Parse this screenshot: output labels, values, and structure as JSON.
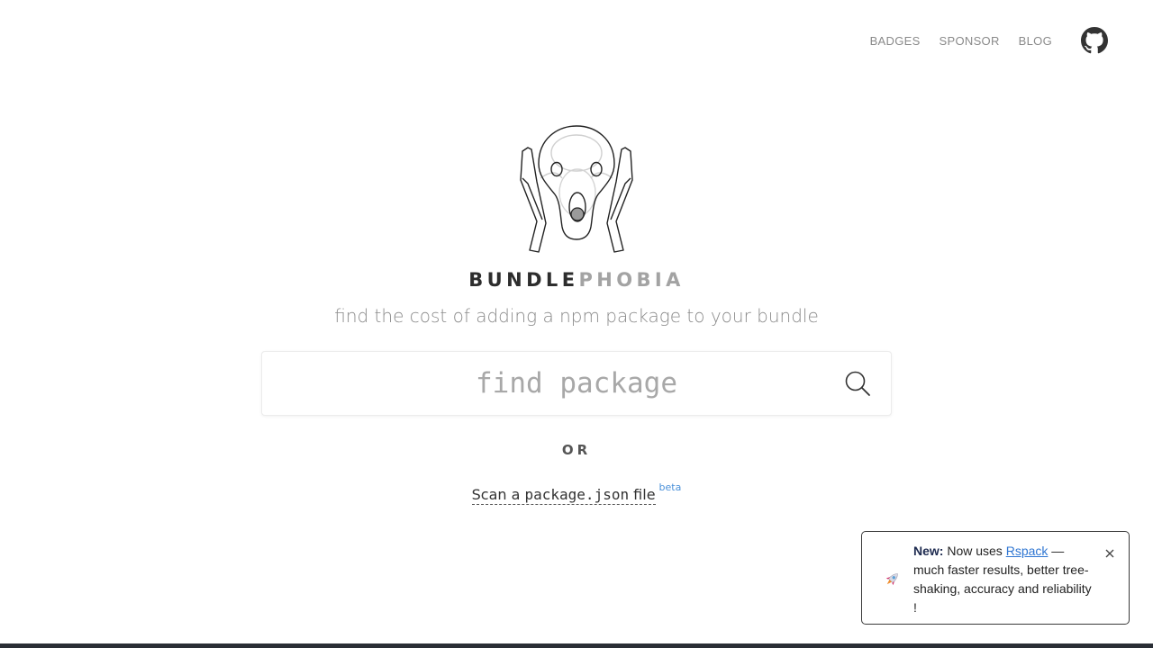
{
  "nav": {
    "items": [
      "BADGES",
      "SPONSOR",
      "BLOG"
    ],
    "github_icon": "github-icon"
  },
  "brand": {
    "part1": "BUNDLE",
    "part2": "PHOBIA",
    "tagline": "find the cost of adding a npm package to your bundle"
  },
  "search": {
    "placeholder": "find package",
    "value": "",
    "icon": "search-icon"
  },
  "or_text": "OR",
  "scan": {
    "prefix": "Scan a ",
    "code": "package.json",
    "suffix": " file",
    "badge": "beta"
  },
  "toast": {
    "icon": "rocket-icon",
    "label": "New:",
    "text_before": " Now uses ",
    "link": "Rspack",
    "text_after": " — much faster results, better tree-shaking, accuracy and reliability !",
    "close_icon": "close-icon"
  },
  "colors": {
    "brand_dark": "#2d2d2d",
    "brand_light": "#a3a3a3",
    "link": "#2f76d2",
    "beta": "#4a90d9"
  }
}
